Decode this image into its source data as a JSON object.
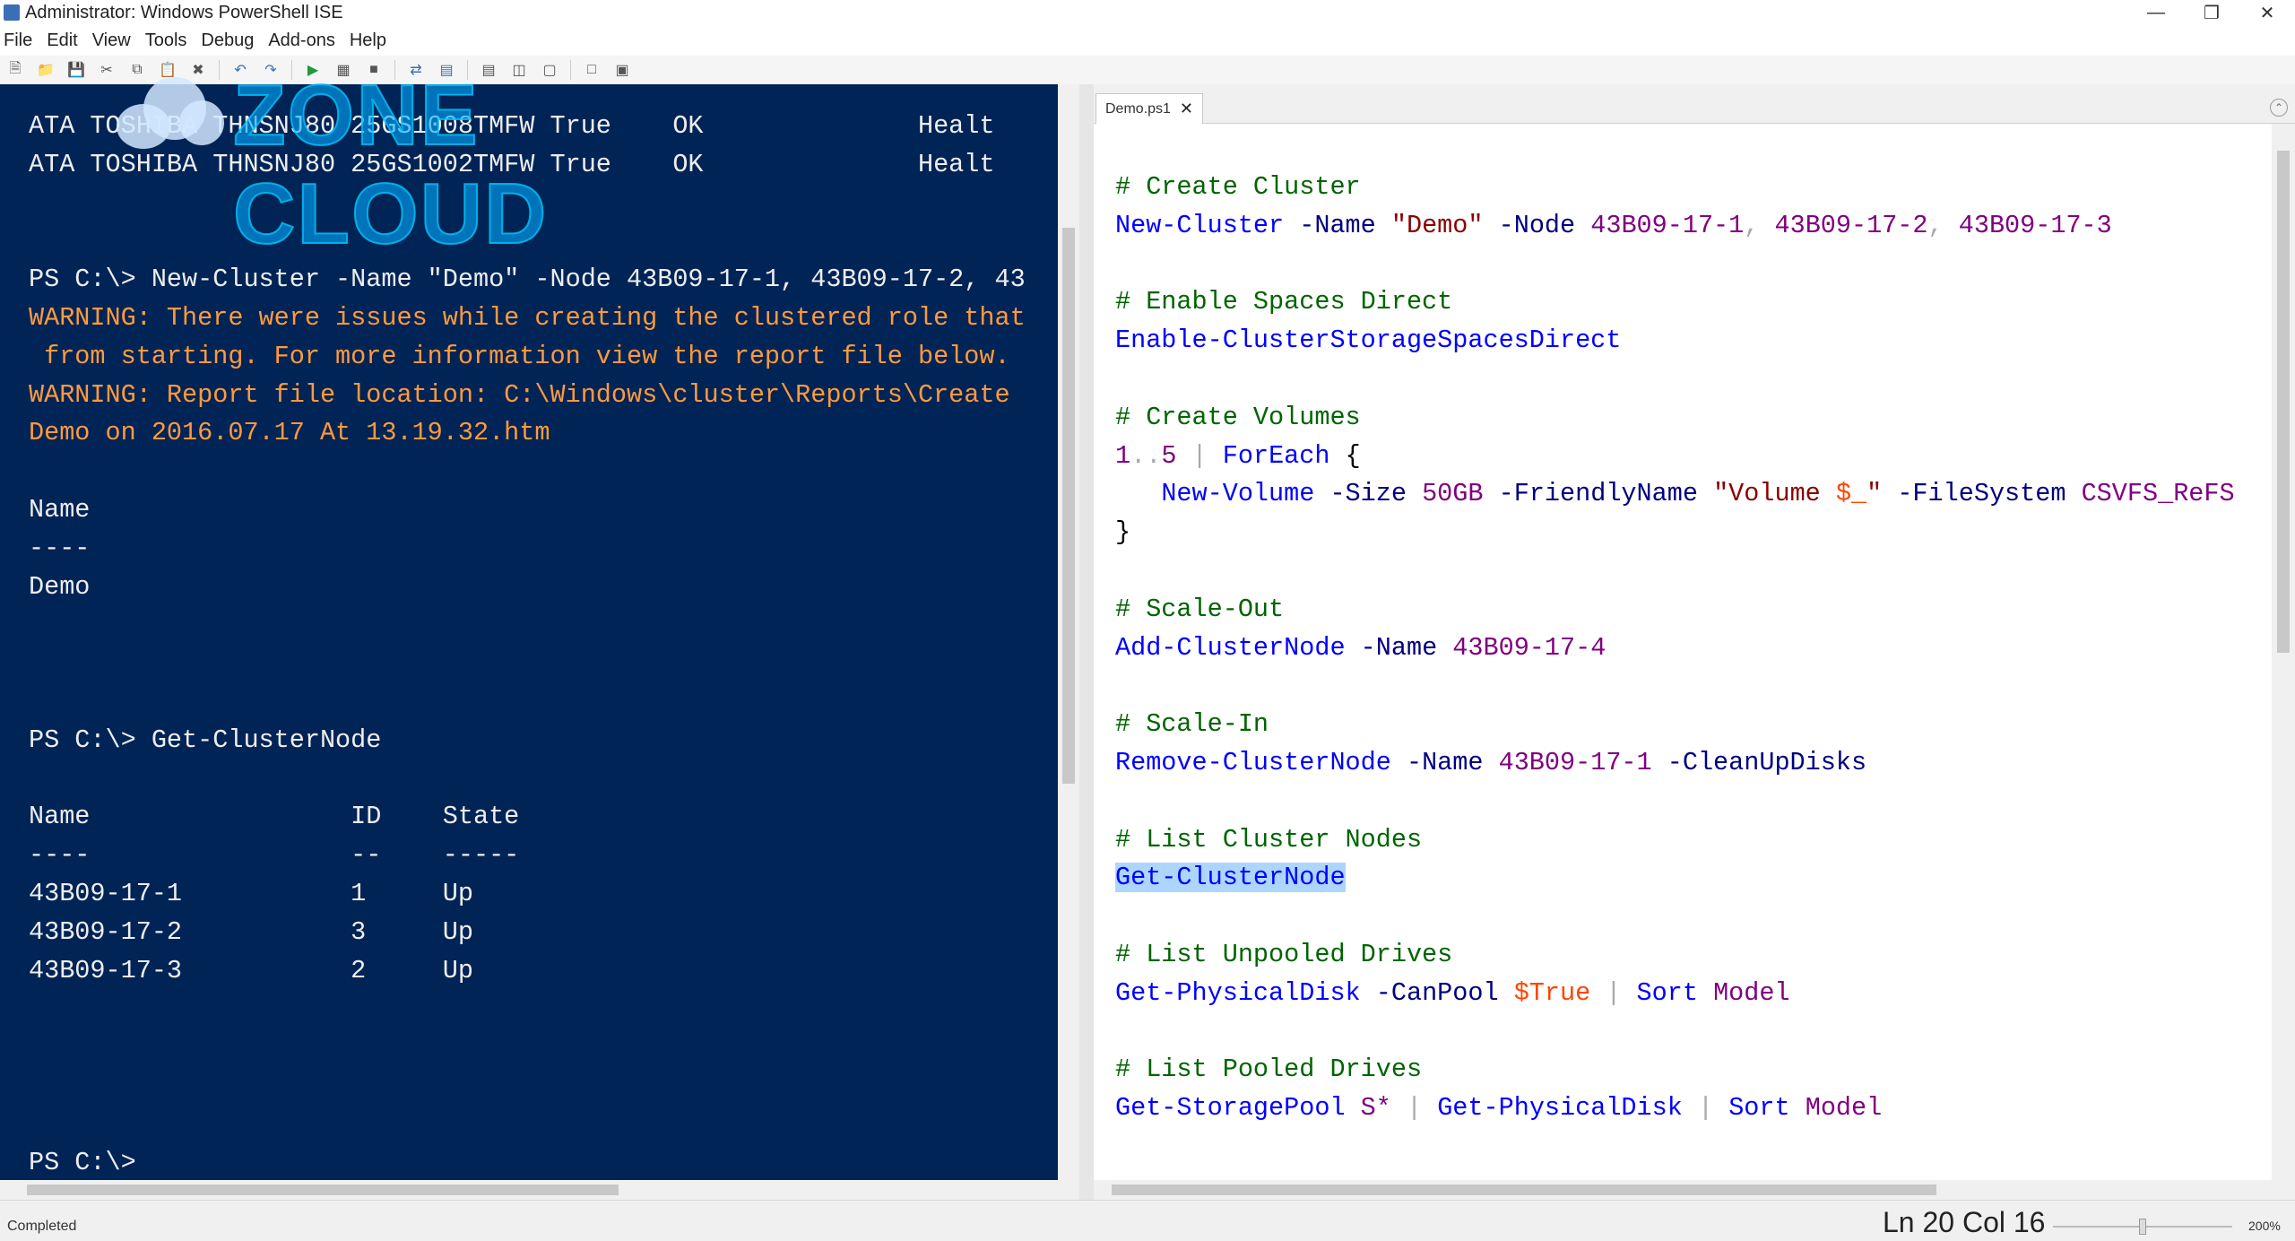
{
  "window": {
    "title": "Administrator: Windows PowerShell ISE"
  },
  "menu": [
    "File",
    "Edit",
    "View",
    "Tools",
    "Debug",
    "Add-ons",
    "Help"
  ],
  "watermark": {
    "text": "ZONE CLOUD"
  },
  "console": {
    "lines": [
      {
        "text": "ATA TOSHIBA THNSNJ80 25GS1008TMFW True    OK              Healt",
        "type": "normal"
      },
      {
        "text": "ATA TOSHIBA THNSNJ80 25GS1002TMFW True    OK              Healt",
        "type": "normal"
      },
      {
        "text": "",
        "type": "normal"
      },
      {
        "text": "",
        "type": "normal"
      },
      {
        "text": "PS C:\\> New-Cluster -Name \"Demo\" -Node 43B09-17-1, 43B09-17-2, 43",
        "type": "normal"
      },
      {
        "text": "WARNING: There were issues while creating the clustered role that",
        "type": "warn"
      },
      {
        "text": " from starting. For more information view the report file below.",
        "type": "warn"
      },
      {
        "text": "WARNING: Report file location: C:\\Windows\\cluster\\Reports\\Create",
        "type": "warn"
      },
      {
        "text": "Demo on 2016.07.17 At 13.19.32.htm",
        "type": "warn"
      },
      {
        "text": "",
        "type": "normal"
      },
      {
        "text": "Name",
        "type": "normal"
      },
      {
        "text": "----",
        "type": "normal"
      },
      {
        "text": "Demo",
        "type": "normal"
      },
      {
        "text": "",
        "type": "normal"
      },
      {
        "text": "",
        "type": "normal"
      },
      {
        "text": "",
        "type": "normal"
      },
      {
        "text": "PS C:\\> Get-ClusterNode",
        "type": "normal"
      },
      {
        "text": "",
        "type": "normal"
      },
      {
        "text": "Name                 ID    State",
        "type": "normal"
      },
      {
        "text": "----                 --    -----",
        "type": "normal"
      },
      {
        "text": "43B09-17-1           1     Up",
        "type": "normal"
      },
      {
        "text": "43B09-17-2           3     Up",
        "type": "normal"
      },
      {
        "text": "43B09-17-3           2     Up",
        "type": "normal"
      },
      {
        "text": "",
        "type": "normal"
      },
      {
        "text": "",
        "type": "normal"
      },
      {
        "text": "",
        "type": "normal"
      },
      {
        "text": "",
        "type": "normal"
      },
      {
        "text": "PS C:\\>",
        "type": "normal"
      }
    ]
  },
  "script": {
    "tab_name": "Demo.ps1",
    "lines": [
      [
        {
          "t": "# Create Cluster",
          "c": "comment"
        }
      ],
      [
        {
          "t": "New-Cluster",
          "c": "cmd"
        },
        {
          "t": " "
        },
        {
          "t": "-Name",
          "c": "param"
        },
        {
          "t": " "
        },
        {
          "t": "\"Demo\"",
          "c": "str"
        },
        {
          "t": " "
        },
        {
          "t": "-Node",
          "c": "param"
        },
        {
          "t": " "
        },
        {
          "t": "43B09-17-1",
          "c": "num"
        },
        {
          "t": ", ",
          "c": "op"
        },
        {
          "t": "43B09-17-2",
          "c": "num"
        },
        {
          "t": ", ",
          "c": "op"
        },
        {
          "t": "43B09-17-3",
          "c": "num"
        }
      ],
      [],
      [
        {
          "t": "# Enable Spaces Direct",
          "c": "comment"
        }
      ],
      [
        {
          "t": "Enable-ClusterStorageSpacesDirect",
          "c": "cmd"
        }
      ],
      [],
      [
        {
          "t": "# Create Volumes",
          "c": "comment"
        }
      ],
      [
        {
          "t": "1",
          "c": "num"
        },
        {
          "t": "..",
          "c": "op"
        },
        {
          "t": "5",
          "c": "num"
        },
        {
          "t": " "
        },
        {
          "t": "|",
          "c": "op"
        },
        {
          "t": " "
        },
        {
          "t": "ForEach",
          "c": "cmd"
        },
        {
          "t": " "
        },
        {
          "t": "{",
          "c": "punct"
        }
      ],
      [
        {
          "t": "   "
        },
        {
          "t": "New-Volume",
          "c": "cmd"
        },
        {
          "t": " "
        },
        {
          "t": "-Size",
          "c": "param"
        },
        {
          "t": " "
        },
        {
          "t": "50GB",
          "c": "num"
        },
        {
          "t": " "
        },
        {
          "t": "-FriendlyName",
          "c": "param"
        },
        {
          "t": " "
        },
        {
          "t": "\"Volume ",
          "c": "str"
        },
        {
          "t": "$_",
          "c": "var"
        },
        {
          "t": "\"",
          "c": "str"
        },
        {
          "t": " "
        },
        {
          "t": "-FileSystem",
          "c": "param"
        },
        {
          "t": " "
        },
        {
          "t": "CSVFS_ReFS",
          "c": "num"
        }
      ],
      [
        {
          "t": "}",
          "c": "punct"
        }
      ],
      [],
      [
        {
          "t": "# Scale-Out",
          "c": "comment"
        }
      ],
      [
        {
          "t": "Add-ClusterNode",
          "c": "cmd"
        },
        {
          "t": " "
        },
        {
          "t": "-Name",
          "c": "param"
        },
        {
          "t": " "
        },
        {
          "t": "43B09-17-4",
          "c": "num"
        }
      ],
      [],
      [
        {
          "t": "# Scale-In",
          "c": "comment"
        }
      ],
      [
        {
          "t": "Remove-ClusterNode",
          "c": "cmd"
        },
        {
          "t": " "
        },
        {
          "t": "-Name",
          "c": "param"
        },
        {
          "t": " "
        },
        {
          "t": "43B09-17-1",
          "c": "num"
        },
        {
          "t": " "
        },
        {
          "t": "-CleanUpDisks",
          "c": "param"
        }
      ],
      [],
      [
        {
          "t": "# List Cluster Nodes",
          "c": "comment"
        }
      ],
      [
        {
          "t": "Get-ClusterNode",
          "c": "cmd",
          "hl": true
        }
      ],
      [],
      [
        {
          "t": "# List Unpooled Drives",
          "c": "comment"
        }
      ],
      [
        {
          "t": "Get-PhysicalDisk",
          "c": "cmd"
        },
        {
          "t": " "
        },
        {
          "t": "-CanPool",
          "c": "param"
        },
        {
          "t": " "
        },
        {
          "t": "$True",
          "c": "var"
        },
        {
          "t": " "
        },
        {
          "t": "|",
          "c": "op"
        },
        {
          "t": " "
        },
        {
          "t": "Sort",
          "c": "cmd"
        },
        {
          "t": " "
        },
        {
          "t": "Model",
          "c": "num"
        }
      ],
      [],
      [
        {
          "t": "# List Pooled Drives",
          "c": "comment"
        }
      ],
      [
        {
          "t": "Get-StoragePool",
          "c": "cmd"
        },
        {
          "t": " "
        },
        {
          "t": "S*",
          "c": "num"
        },
        {
          "t": " "
        },
        {
          "t": "|",
          "c": "op"
        },
        {
          "t": " "
        },
        {
          "t": "Get-PhysicalDisk",
          "c": "cmd"
        },
        {
          "t": " "
        },
        {
          "t": "|",
          "c": "op"
        },
        {
          "t": " "
        },
        {
          "t": "Sort",
          "c": "cmd"
        },
        {
          "t": " "
        },
        {
          "t": "Model",
          "c": "num"
        }
      ]
    ]
  },
  "status": {
    "text": "Completed",
    "position": "Ln 20  Col 16",
    "zoom": "200%"
  },
  "colors": {
    "console_bg": "#012456",
    "warning": "#ff9a3c",
    "selection": "#add6ff"
  }
}
